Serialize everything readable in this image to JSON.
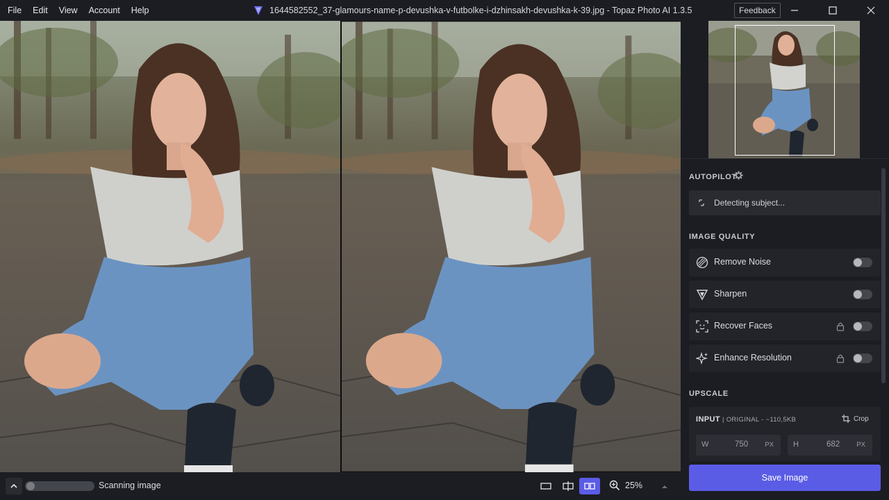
{
  "menu": [
    "File",
    "Edit",
    "View",
    "Account",
    "Help"
  ],
  "window": {
    "title": "1644582552_37-glamours-name-p-devushka-v-futbolke-i-dzhinsakh-devushka-k-39.jpg - Topaz Photo AI 1.3.5",
    "feedback_label": "Feedback"
  },
  "autopilot": {
    "title": "AUTOPILOT",
    "status": "Detecting subject..."
  },
  "image_quality": {
    "title": "IMAGE QUALITY",
    "tools": [
      {
        "label": "Remove Noise",
        "icon": "remove-noise-icon",
        "locked": false,
        "enabled": false
      },
      {
        "label": "Sharpen",
        "icon": "sharpen-icon",
        "locked": false,
        "enabled": false
      },
      {
        "label": "Recover Faces",
        "icon": "recover-faces-icon",
        "locked": true,
        "enabled": false
      },
      {
        "label": "Enhance Resolution",
        "icon": "enhance-resolution-icon",
        "locked": true,
        "enabled": false
      }
    ]
  },
  "upscale": {
    "title": "UPSCALE",
    "input_label": "INPUT",
    "input_sub": "| ORIGINAL - ~110,5KB",
    "crop_label": "Crop",
    "width_letter": "W",
    "width_value": "750",
    "height_letter": "H",
    "height_value": "682",
    "unit": "PX"
  },
  "save_label": "Save Image",
  "bottom": {
    "scan_status": "Scanning image",
    "zoom": "25%"
  },
  "colors": {
    "accent": "#5b5ce6",
    "panel_bg": "#1c1d22",
    "row_bg": "#23242a"
  }
}
